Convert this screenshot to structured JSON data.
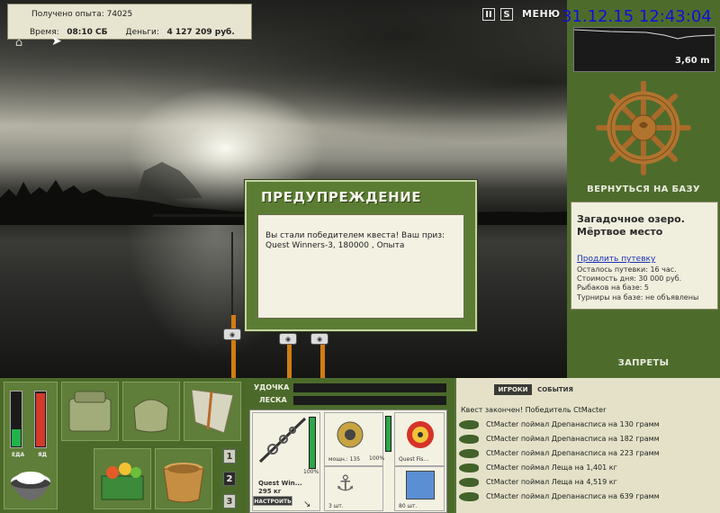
{
  "info": {
    "exp_text": "Получено опыта: 74025",
    "time_label": "Время:",
    "time_value": "08:10 СБ",
    "money_label": "Деньги:",
    "money_value": "4 127 209 руб."
  },
  "topbar": {
    "pause": "II",
    "sound": "S",
    "menu": "МЕНЮ",
    "clock": "31.12.15 12:43:04"
  },
  "sonar": {
    "depth": "3,60 m"
  },
  "right": {
    "return_base": "ВЕРНУТЬСЯ НА БАЗУ",
    "location_title": "Загадочное озеро. Мёртвое место",
    "extend_link": "Продлить путевку",
    "left_text": "Осталось путевки: 16 час.",
    "cost_text": "Стоимость дня: 30 000 руб.",
    "fishers_text": "Рыбаков на базе: 5",
    "tournaments_text": "Турниры на базе: не объявлены",
    "bans": "ЗАПРЕТЫ"
  },
  "dialog": {
    "title": "ПРЕДУПРЕЖДЕНИЕ",
    "message": "Вы стали победителем квеста! Ваш приз: Quest Winners-3, 180000 , Опыта"
  },
  "status": {
    "food_label": "ЕДА",
    "poison_label": "ЯД",
    "food_level": 0.3,
    "poison_level": 0.95
  },
  "slots": {
    "n1": "1",
    "n2": "2",
    "n3": "3"
  },
  "tackle": {
    "rod_label": "УДОЧКА",
    "line_label": "ЛЕСКА",
    "rod_name": "Quest Win...",
    "rod_weight": "295 кг",
    "rod_percent": "100%",
    "tune_button": "НАСТРОИТЬ",
    "reel_power": "мощн.: 135",
    "reel_percent": "100%",
    "line_name": "Quest Fis...",
    "hooks_count": "3 шт.",
    "bait_count": "80 шт."
  },
  "log": {
    "tab_players": "ИГРОКИ",
    "tab_events": "СОБЫТИЯ",
    "top_message": "Квест закончен! Победитель CtMacter",
    "entries": [
      "CtMacter поймал Дрепанасписа на 130 грамм",
      "CtMacter поймал Дрепанасписа на 182 грамм",
      "CtMacter поймал Дрепанасписа на 223 грамм",
      "CtMacter поймал Леща на 1,401 кг",
      "CtMacter поймал Леща на 4,519 кг",
      "CtMacter поймал Дрепанасписа на 639 грамм"
    ]
  }
}
